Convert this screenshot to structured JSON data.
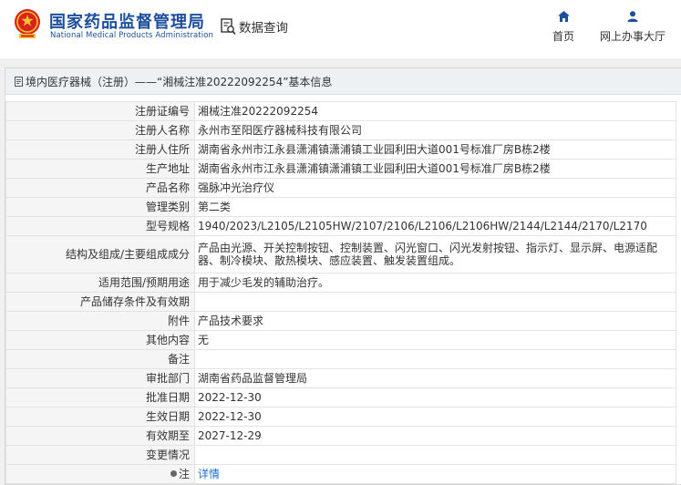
{
  "header": {
    "title_cn": "国家药品监督管理局",
    "title_en": "National Medical Products Administration",
    "query_label": "数据查询",
    "nav": {
      "home": "首页",
      "online_hall": "网上办事大厅"
    }
  },
  "breadcrumb": {
    "text": "境内医疗器械（注册）——“湘械注准20222092254”基本信息"
  },
  "record": {
    "rows": [
      {
        "label": "注册证编号",
        "value": "湘械注准20222092254"
      },
      {
        "label": "注册人名称",
        "value": "永州市至阳医疗器械科技有限公司"
      },
      {
        "label": "注册人住所",
        "value": "湖南省永州市江永县潇浦镇潇浦镇工业园利田大道001号标准厂房B栋2楼"
      },
      {
        "label": "生产地址",
        "value": "湖南省永州市江永县潇浦镇潇浦镇工业园利田大道001号标准厂房B栋2楼"
      },
      {
        "label": "产品名称",
        "value": "强脉冲光治疗仪"
      },
      {
        "label": "管理类别",
        "value": "第二类"
      },
      {
        "label": "型号规格",
        "value": "1940/2023/L2105/L2105HW/2107/2106/L2106/L2106HW/2144/L2144/2170/L2170"
      },
      {
        "label": "结构及组成/主要组成成分",
        "value": "产品由光源、开关控制按钮、控制装置、闪光窗口、闪光发射按钮、指示灯、显示屏、电源适配器、制冷模块、散热模块、感应装置、触发装置组成。"
      },
      {
        "label": "适用范围/预期用途",
        "value": "用于减少毛发的辅助治疗。"
      },
      {
        "label": "产品储存条件及有效期",
        "value": ""
      },
      {
        "label": "附件",
        "value": "产品技术要求"
      },
      {
        "label": "其他内容",
        "value": "无"
      },
      {
        "label": "备注",
        "value": ""
      },
      {
        "label": "审批部门",
        "value": "湖南省药品监督管理局"
      },
      {
        "label": "批准日期",
        "value": "2022-12-30"
      },
      {
        "label": "生效日期",
        "value": "2022-12-30"
      },
      {
        "label": "有效期至",
        "value": "2027-12-29"
      },
      {
        "label": "变更情况",
        "value": ""
      }
    ],
    "note_label": "注",
    "detail_link": "详情"
  },
  "colors": {
    "brand_blue": "#1c4e9c",
    "emblem_red": "#d9221c",
    "link_blue": "#1c6fd1"
  }
}
